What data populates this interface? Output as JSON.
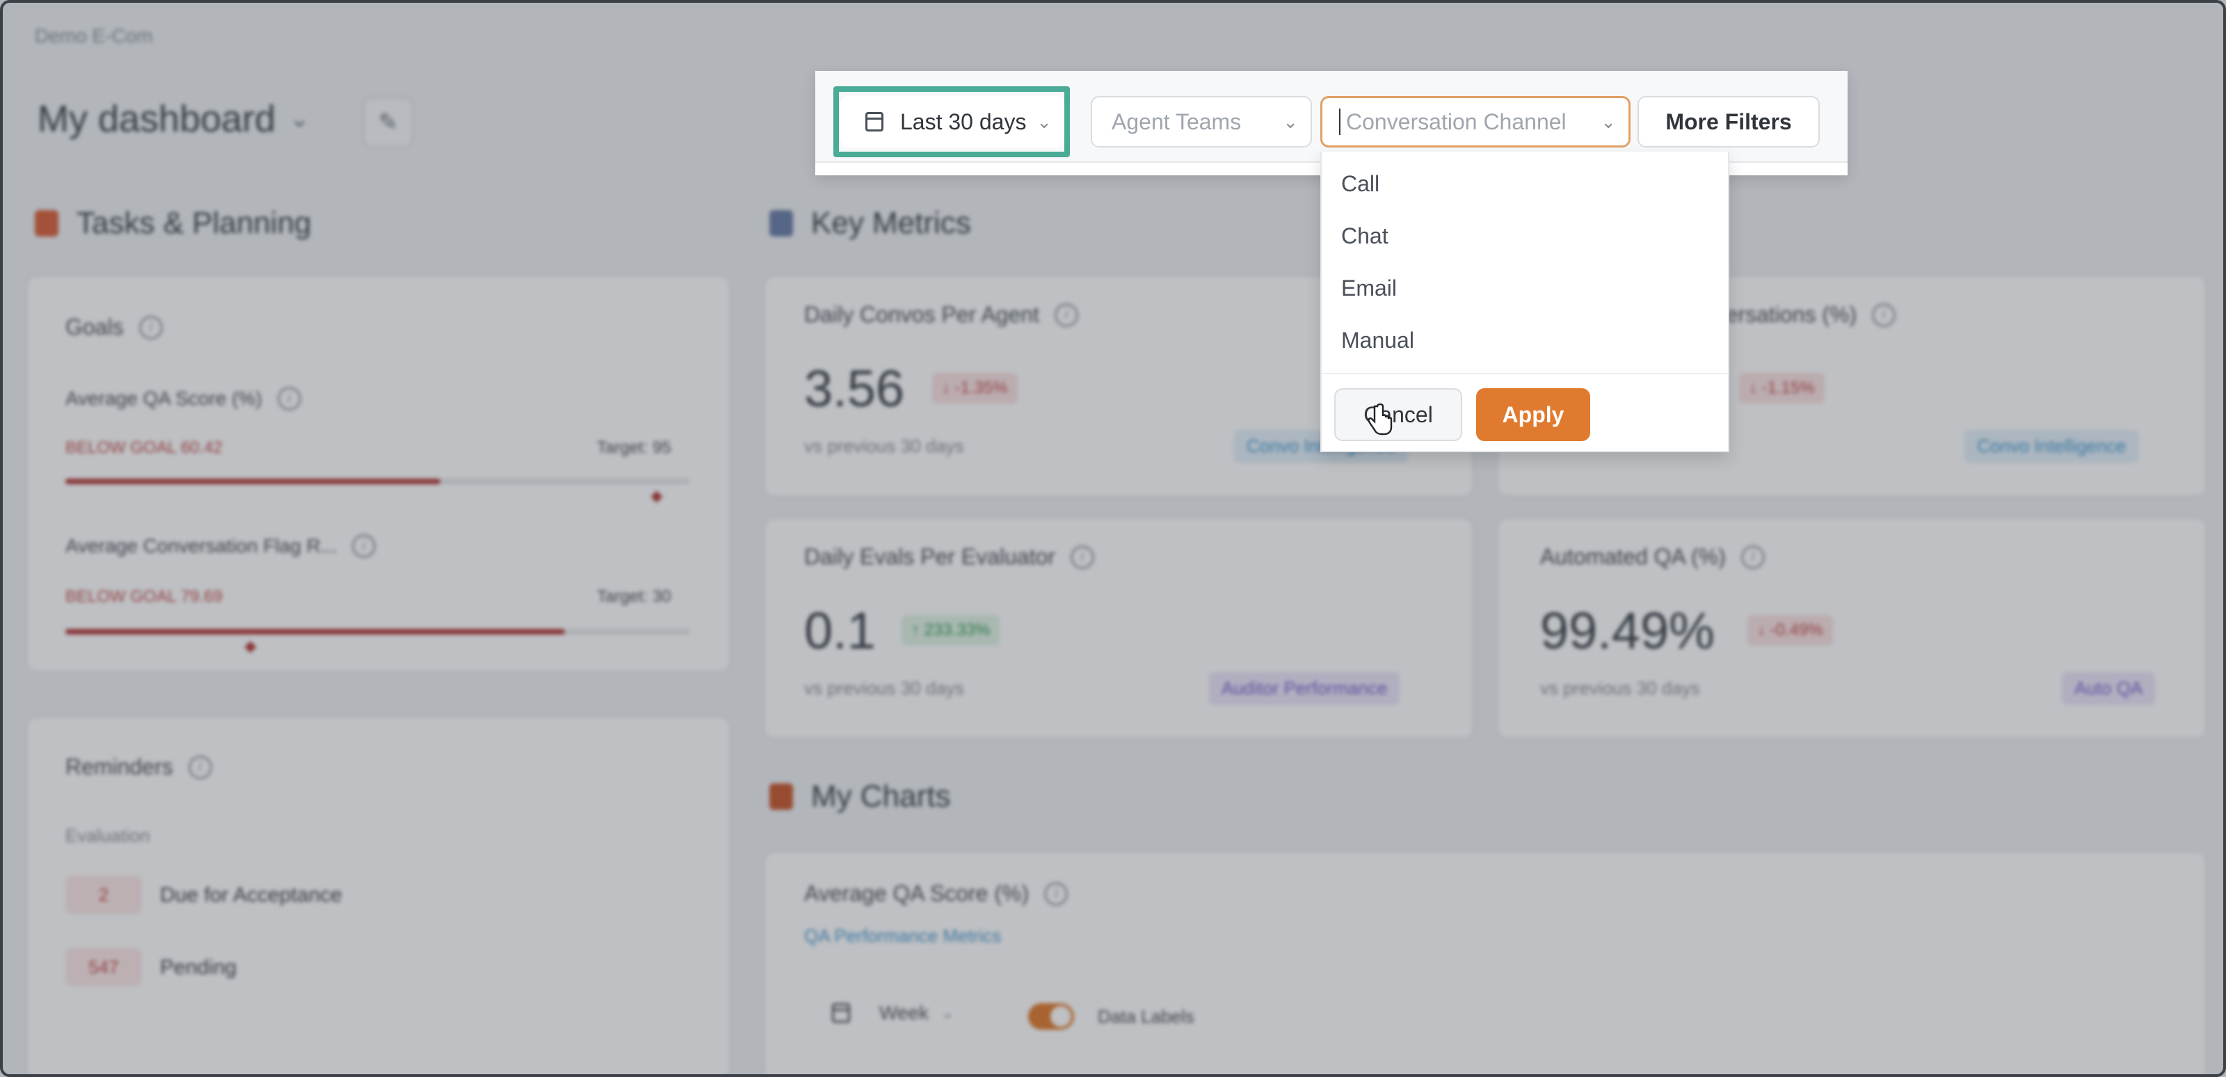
{
  "app": {
    "org_name": "Demo E-Com",
    "dashboard_title": "My dashboard"
  },
  "tasks": {
    "section_title": "Tasks & Planning",
    "goals": {
      "title": "Goals",
      "items": [
        {
          "name": "Average QA Score (%)",
          "status": "BELOW GOAL 60.42",
          "target": "Target: 95",
          "progress": 0.6
        },
        {
          "name": "Average Conversation Flag R...",
          "status": "BELOW GOAL 79.69",
          "target": "Target: 30",
          "progress": 0.8
        }
      ]
    },
    "reminders": {
      "title": "Reminders",
      "group": "Evaluation",
      "items": [
        {
          "count": "2",
          "label": "Due for Acceptance"
        },
        {
          "count": "547",
          "label": "Pending"
        }
      ]
    }
  },
  "metrics": {
    "section_title": "Key Metrics",
    "cards": [
      {
        "title": "Daily Convos Per Agent",
        "value": "3.56",
        "delta": "↓ -1.35%",
        "delta_type": "neg",
        "sub": "vs previous 30 days",
        "tag": "Convo Intelligence",
        "tag_color": "blue"
      },
      {
        "title": "...ersations (%)",
        "value": "",
        "delta": "↓ -1.15%",
        "delta_type": "neg",
        "sub": "",
        "tag": "Convo Intelligence",
        "tag_color": "blue"
      },
      {
        "title": "Daily Evals Per Evaluator",
        "value": "0.1",
        "delta": "↑ 233.33%",
        "delta_type": "pos",
        "sub": "vs previous 30 days",
        "tag": "Auditor Performance",
        "tag_color": "purple"
      },
      {
        "title": "Automated QA (%)",
        "value": "99.49%",
        "delta": "↓ -0.49%",
        "delta_type": "neg",
        "sub": "vs previous 30 days",
        "tag": "Auto QA",
        "tag_color": "purple"
      }
    ]
  },
  "charts": {
    "section_title": "My Charts",
    "card_title": "Average QA Score (%)",
    "card_link": "QA Performance Metrics",
    "period": "Week",
    "data_labels": "Data Labels"
  },
  "filters": {
    "date": "Last 30 days",
    "agent_teams_placeholder": "Agent Teams",
    "channel_placeholder": "Conversation Channel",
    "more_filters": "More Filters"
  },
  "dropdown": {
    "options": [
      "Call",
      "Chat",
      "Email",
      "Manual"
    ],
    "cancel": "Cancel",
    "apply": "Apply"
  },
  "colors": {
    "accent": "#e07a2e",
    "highlight": "#4aab97",
    "negative": "#c24a4a",
    "positive": "#2f9b53"
  }
}
